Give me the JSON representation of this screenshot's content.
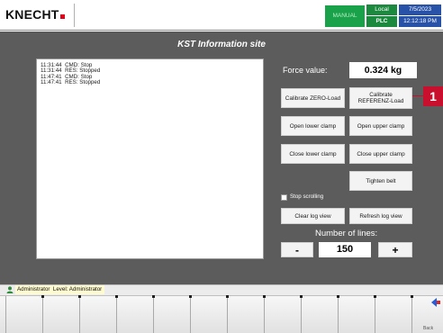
{
  "header": {
    "logo": "KNECHT",
    "mode": "MANUAL",
    "location": "Local",
    "control": "PLC",
    "date": "7/5/2023",
    "time": "12:12:18 PM",
    "colors": {
      "mode_bg": "#19a24a",
      "status_bg": "#1b8a3e",
      "datetime_bg": "#2752a8",
      "logo_accent": "#e3001b"
    }
  },
  "page": {
    "title": "KST Information site",
    "background": "#5c5c5c"
  },
  "log": {
    "lines": [
      "11:31:44  CMD: Stop",
      "11:31:44  RES: Stopped",
      "11:47:41  CMD: Stop",
      "11:47:41  RES: Stopped"
    ]
  },
  "force": {
    "label": "Force value:",
    "value": "0.324 kg"
  },
  "buttons": {
    "calibrate_zero": "Calibrate ZERO-Load",
    "calibrate_ref_line1": "Calibrate",
    "calibrate_ref_line2": "REFERENZ-Load",
    "open_lower": "Open lower clamp",
    "open_upper": "Open upper clamp",
    "close_lower": "Close lower clamp",
    "close_upper": "Close upper clamp",
    "tighten": "Tighten belt",
    "clear_log": "Clear log view",
    "refresh_log": "Refresh log view"
  },
  "stop_scrolling": {
    "label": "Stop scrolling",
    "checked": false
  },
  "lines": {
    "label": "Number of lines:",
    "value": "150",
    "minus": "-",
    "plus": "+"
  },
  "marker": {
    "number": "1",
    "color": "#c8102e"
  },
  "status": {
    "user": "Administrator",
    "level": "Level: Administrator"
  },
  "fkeys": {
    "back_label": "Back",
    "back_icon": "back-arrow-icon"
  }
}
